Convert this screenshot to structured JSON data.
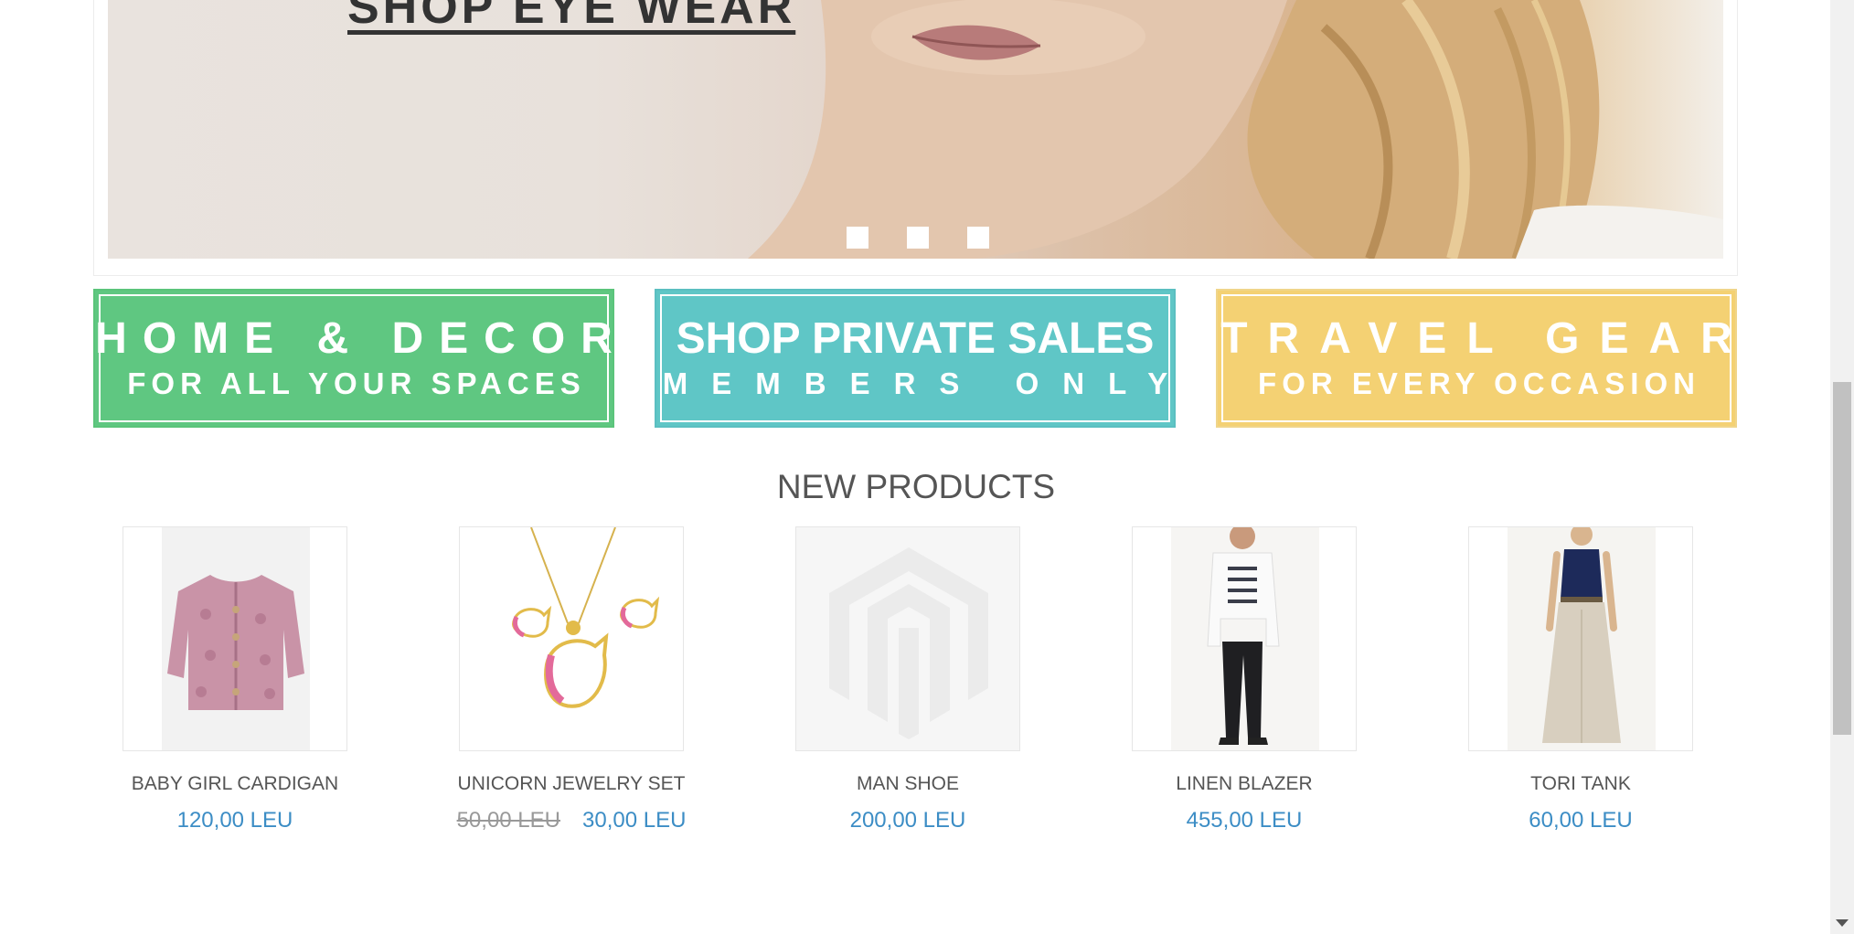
{
  "hero": {
    "cta_label": "SHOP EYE WEAR",
    "dots": [
      "slide-1",
      "slide-2",
      "slide-3"
    ]
  },
  "promos": [
    {
      "line1": "HOME & DECOR",
      "line2": "FOR ALL YOUR SPACES",
      "color": "#5fc781"
    },
    {
      "line1": "SHOP PRIVATE SALES",
      "line2": "MEMBERS ONLY",
      "color": "#5fc6c6"
    },
    {
      "line1": "TRAVEL GEAR",
      "line2": "FOR EVERY OCCASION",
      "color": "#f4d173"
    }
  ],
  "new_products": {
    "title": "NEW PRODUCTS",
    "items": [
      {
        "name": "BABY GIRL CARDIGAN",
        "price": "120,00 LEU",
        "image": "pink-cardigan-image"
      },
      {
        "name": "UNICORN JEWELRY SET",
        "old_price": "50,00 LEU",
        "price": "30,00 LEU",
        "image": "unicorn-jewelry-image"
      },
      {
        "name": "MAN SHOE",
        "price": "200,00 LEU",
        "image": "placeholder-logo-image"
      },
      {
        "name": "LINEN BLAZER",
        "price": "455,00 LEU",
        "image": "man-blazer-image"
      },
      {
        "name": "TORI TANK",
        "price": "60,00 LEU",
        "image": "woman-tank-image"
      }
    ]
  },
  "colors": {
    "price": "#3c8dc5",
    "title": "#555555"
  }
}
